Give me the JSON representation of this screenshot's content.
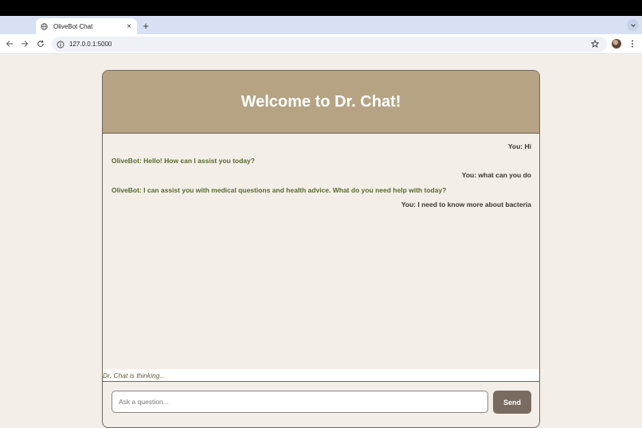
{
  "browser": {
    "tab_title": "OliveBot Chat",
    "tab_close": "×",
    "new_tab": "+",
    "url": "127.0.0.1:5000"
  },
  "chat": {
    "header_title": "Welcome to Dr. Chat!",
    "messages": [
      {
        "sender": "user",
        "text": "You: Hi"
      },
      {
        "sender": "bot",
        "text": "OliveBot: Hello! How can I assist you today?"
      },
      {
        "sender": "user",
        "text": "You: what can you do"
      },
      {
        "sender": "bot",
        "text": "OliveBot: I can assist you with medical questions and health advice. What do you need help with today?"
      },
      {
        "sender": "user",
        "text": "You: I need to know more about bacteria"
      }
    ],
    "typing_indicator": "Dr. Chat is thinking...",
    "input_placeholder": "Ask a question...",
    "send_label": "Send"
  },
  "colors": {
    "page_background": "#f3eee7",
    "header_background": "#b5a384",
    "bot_text": "#566b2e",
    "user_text": "#3d3530",
    "send_button": "#796b60"
  }
}
